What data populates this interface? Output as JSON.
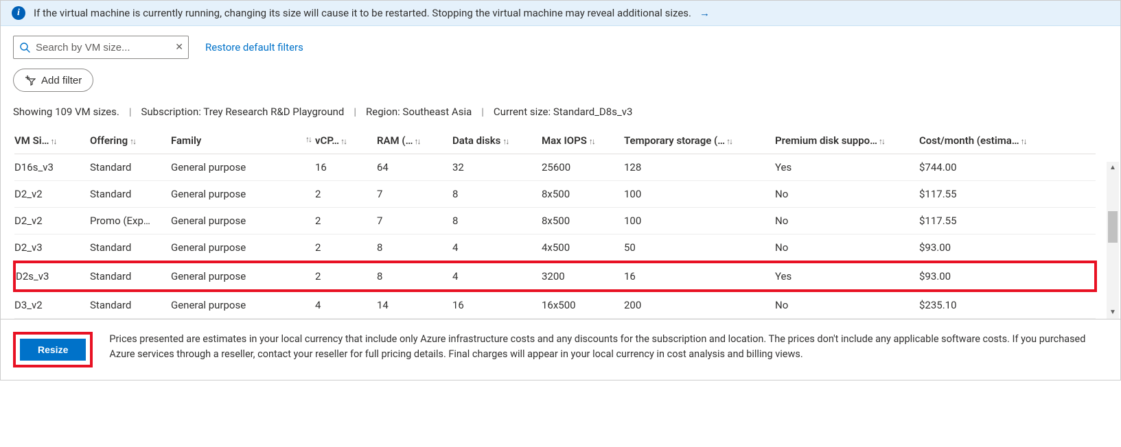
{
  "banner": {
    "text": "If the virtual machine is currently running, changing its size will cause it to be restarted. Stopping the virtual machine may reveal additional sizes.",
    "arrow": "→"
  },
  "search": {
    "placeholder": "Search by VM size..."
  },
  "links": {
    "restore_filters": "Restore default filters"
  },
  "buttons": {
    "add_filter": "Add filter",
    "resize": "Resize"
  },
  "status": {
    "showing": "Showing 109 VM sizes.",
    "subscription_label": "Subscription:",
    "subscription_value": "Trey Research R&D Playground",
    "region_label": "Region:",
    "region_value": "Southeast Asia",
    "current_label": "Current size:",
    "current_value": "Standard_D8s_v3"
  },
  "columns": {
    "vm_size": "VM Si…",
    "offering": "Offering",
    "family": "Family",
    "vcpus": "vCP…",
    "ram": "RAM (…",
    "data_disks": "Data disks",
    "max_iops": "Max IOPS",
    "temp_storage": "Temporary storage (…",
    "premium_disk": "Premium disk suppo…",
    "cost": "Cost/month (estima…"
  },
  "rows": [
    {
      "vm_size": "D16s_v3",
      "offering": "Standard",
      "family": "General purpose",
      "vcpus": "16",
      "ram": "64",
      "data_disks": "32",
      "max_iops": "25600",
      "temp_storage": "128",
      "premium_disk": "Yes",
      "cost": "$744.00",
      "highlighted": false
    },
    {
      "vm_size": "D2_v2",
      "offering": "Standard",
      "family": "General purpose",
      "vcpus": "2",
      "ram": "7",
      "data_disks": "8",
      "max_iops": "8x500",
      "temp_storage": "100",
      "premium_disk": "No",
      "cost": "$117.55",
      "highlighted": false
    },
    {
      "vm_size": "D2_v2",
      "offering": "Promo (Exp…",
      "family": "General purpose",
      "vcpus": "2",
      "ram": "7",
      "data_disks": "8",
      "max_iops": "8x500",
      "temp_storage": "100",
      "premium_disk": "No",
      "cost": "$117.55",
      "highlighted": false
    },
    {
      "vm_size": "D2_v3",
      "offering": "Standard",
      "family": "General purpose",
      "vcpus": "2",
      "ram": "8",
      "data_disks": "4",
      "max_iops": "4x500",
      "temp_storage": "50",
      "premium_disk": "No",
      "cost": "$93.00",
      "highlighted": false
    },
    {
      "vm_size": "D2s_v3",
      "offering": "Standard",
      "family": "General purpose",
      "vcpus": "2",
      "ram": "8",
      "data_disks": "4",
      "max_iops": "3200",
      "temp_storage": "16",
      "premium_disk": "Yes",
      "cost": "$93.00",
      "highlighted": true
    },
    {
      "vm_size": "D3_v2",
      "offering": "Standard",
      "family": "General purpose",
      "vcpus": "4",
      "ram": "14",
      "data_disks": "16",
      "max_iops": "16x500",
      "temp_storage": "200",
      "premium_disk": "No",
      "cost": "$235.10",
      "highlighted": false
    }
  ],
  "footer": {
    "disclaimer": "Prices presented are estimates in your local currency that include only Azure infrastructure costs and any discounts for the subscription and location. The prices don't include any applicable software costs. If you purchased Azure services through a reseller, contact your reseller for full pricing details. Final charges will appear in your local currency in cost analysis and billing views."
  }
}
